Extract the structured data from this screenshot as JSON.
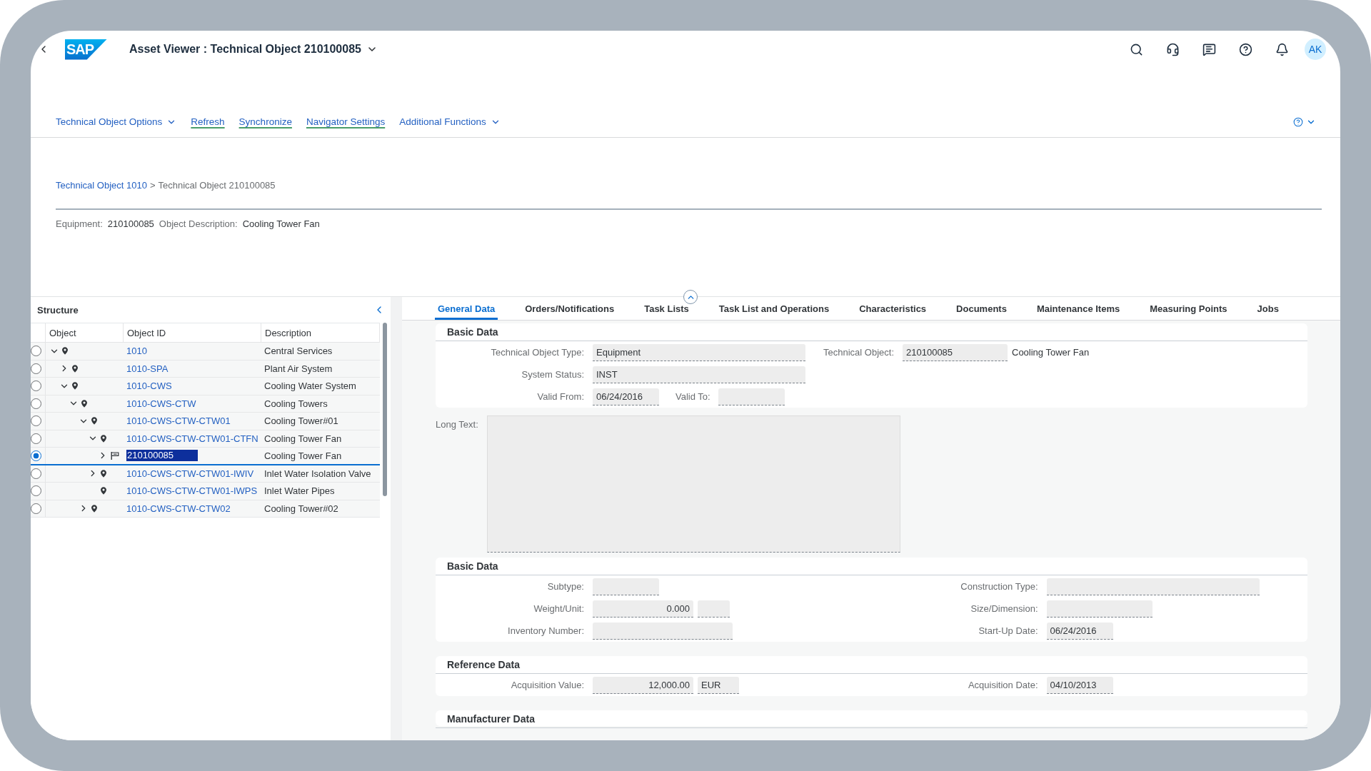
{
  "shell": {
    "logo": "SAP",
    "title": "Asset Viewer : Technical Object 210100085",
    "avatar": "AK"
  },
  "toolbar": {
    "actions": [
      {
        "label": "Technical Object Options",
        "kind": "menu"
      },
      {
        "label": "Refresh",
        "kind": "link"
      },
      {
        "label": "Synchronize",
        "kind": "link"
      },
      {
        "label": "Navigator Settings",
        "kind": "link"
      },
      {
        "label": "Additional Functions",
        "kind": "menu"
      }
    ]
  },
  "breadcrumb": {
    "items": [
      {
        "text": "Technical Object 1010",
        "kind": "link"
      },
      {
        "text": "Technical Object 210100085",
        "kind": "current"
      }
    ],
    "separator": ">"
  },
  "header_info": [
    {
      "label": "Equipment:",
      "value": "210100085"
    },
    {
      "label": "Object Description:",
      "value": "Cooling Tower Fan"
    }
  ],
  "structure": {
    "title": "Structure",
    "columns": [
      "Object",
      "Object ID",
      "Description"
    ],
    "tree": [
      {
        "object_id": "1010",
        "description": "Central Services",
        "kind": "location",
        "expanded": true,
        "selected": false,
        "children": [
          {
            "object_id": "1010-SPA",
            "description": "Plant Air System",
            "kind": "location",
            "expanded": false,
            "selected": false
          },
          {
            "object_id": "1010-CWS",
            "description": "Cooling Water System",
            "kind": "location",
            "expanded": true,
            "selected": false,
            "children": [
              {
                "object_id": "1010-CWS-CTW",
                "description": "Cooling Towers",
                "kind": "location",
                "expanded": true,
                "selected": false,
                "children": [
                  {
                    "object_id": "1010-CWS-CTW-CTW01",
                    "description": "Cooling Tower#01",
                    "kind": "location",
                    "expanded": true,
                    "selected": false,
                    "children": [
                      {
                        "object_id": "1010-CWS-CTW-CTW01-CTFN",
                        "description": "Cooling Tower Fan",
                        "kind": "location",
                        "expanded": true,
                        "selected": false,
                        "children": [
                          {
                            "object_id": "210100085",
                            "description": "Cooling Tower Fan",
                            "kind": "equipment",
                            "expanded": false,
                            "selected": true
                          }
                        ]
                      },
                      {
                        "object_id": "1010-CWS-CTW-CTW01-IWIV",
                        "description": "Inlet Water Isolation Valve",
                        "kind": "location",
                        "expanded": false,
                        "selected": false
                      },
                      {
                        "object_id": "1010-CWS-CTW-CTW01-IWPS",
                        "description": "Inlet Water Pipes",
                        "kind": "location",
                        "selected": false
                      }
                    ]
                  },
                  {
                    "object_id": "1010-CWS-CTW-CTW02",
                    "description": "Cooling Tower#02",
                    "kind": "location",
                    "expanded": false,
                    "selected": false
                  }
                ]
              }
            ]
          }
        ]
      }
    ]
  },
  "tabs": [
    {
      "label": "General Data",
      "selected": true
    },
    {
      "label": "Orders/Notifications",
      "selected": false
    },
    {
      "label": "Task Lists",
      "selected": false
    },
    {
      "label": "Task List and Operations",
      "selected": false
    },
    {
      "label": "Characteristics",
      "selected": false
    },
    {
      "label": "Documents",
      "selected": false
    },
    {
      "label": "Maintenance Items",
      "selected": false
    },
    {
      "label": "Measuring Points",
      "selected": false
    },
    {
      "label": "Jobs",
      "selected": false
    }
  ],
  "general_data": {
    "blocks": [
      {
        "kind": "compact_section",
        "title": "Basic Data",
        "columns": [
          [
            {
              "parts": [
                {
                  "kind": "label",
                  "text": "Technical Object Type:"
                },
                {
                  "kind": "input",
                  "value": "Equipment"
                }
              ]
            },
            {
              "parts": [
                {
                  "kind": "label",
                  "text": "System Status:"
                },
                {
                  "kind": "input",
                  "value": "INST"
                }
              ]
            },
            {
              "parts": [
                {
                  "kind": "label",
                  "text": "Valid From:"
                },
                {
                  "kind": "input",
                  "value": "06/24/2016"
                },
                {
                  "kind": "label",
                  "text": "Valid To:"
                },
                {
                  "kind": "input"
                }
              ]
            }
          ],
          [
            {
              "parts": [
                {
                  "kind": "label",
                  "text": "Technical Object:"
                },
                {
                  "kind": "input",
                  "value": "210100085"
                },
                {
                  "kind": "text",
                  "text": "Cooling Tower Fan"
                }
              ]
            }
          ]
        ]
      },
      {
        "kind": "long_text",
        "label": "Long Text:"
      },
      {
        "kind": "section",
        "title": "Basic Data",
        "columns": [
          [
            {
              "parts": [
                {
                  "kind": "label",
                  "text": "Subtype:"
                },
                {
                  "kind": "input"
                }
              ]
            },
            {
              "parts": [
                {
                  "kind": "label",
                  "text": "Weight/Unit:"
                },
                {
                  "kind": "amount",
                  "value": "0.000"
                },
                {
                  "kind": "input"
                }
              ]
            },
            {
              "parts": [
                {
                  "kind": "label",
                  "text": "Inventory Number:"
                },
                {
                  "kind": "input"
                }
              ]
            }
          ],
          [
            {
              "parts": [
                {
                  "kind": "label",
                  "text": "Construction Type:"
                },
                {
                  "kind": "input"
                }
              ]
            },
            {
              "parts": [
                {
                  "kind": "label",
                  "text": "Size/Dimension:"
                },
                {
                  "kind": "input"
                }
              ]
            },
            {
              "parts": [
                {
                  "kind": "label",
                  "text": "Start-Up Date:"
                },
                {
                  "kind": "input",
                  "value": "06/24/2016"
                }
              ]
            }
          ]
        ]
      },
      {
        "kind": "section",
        "title": "Reference Data",
        "columns": [
          [
            {
              "parts": [
                {
                  "kind": "label",
                  "text": "Acquisition Value:"
                },
                {
                  "kind": "amount",
                  "value": "12,000.00"
                },
                {
                  "kind": "input",
                  "value": "EUR"
                }
              ]
            }
          ],
          [
            {
              "parts": [
                {
                  "kind": "label",
                  "text": "Acquisition Date:"
                },
                {
                  "kind": "input",
                  "value": "04/10/2013"
                }
              ]
            }
          ]
        ]
      },
      {
        "kind": "section",
        "title": "Manufacturer Data"
      }
    ]
  }
}
